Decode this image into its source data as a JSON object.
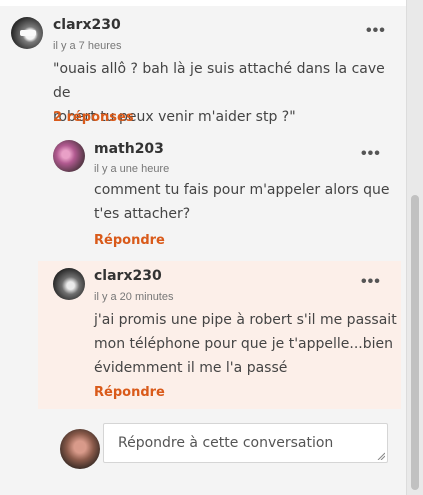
{
  "comment": {
    "username": "clarx230",
    "time": "il y a 7 heures",
    "text_line1": "\"ouais allô ? bah là je suis attaché dans la cave de",
    "text_line2": "robert tu peux venir m'aider stp ?\"",
    "replies_label": "2 réponses"
  },
  "replies": [
    {
      "username": "math203",
      "time": "il y a une heure",
      "text_line1": "comment tu fais pour m'appeler alors que",
      "text_line2": "t'es attacher?",
      "reply_label": "Répondre"
    },
    {
      "username": "clarx230",
      "time": "il y a 20 minutes",
      "text_line1": "j'ai promis une pipe à robert s'il me passait",
      "text_line2": "mon téléphone pour que je t'appelle...bien",
      "text_line3": "évidemment il me l'a passé",
      "reply_label": "Répondre"
    }
  ],
  "composer": {
    "placeholder": "Répondre à cette conversation"
  },
  "icons": {
    "more": "more-options-icon",
    "avatar": "avatar-image"
  },
  "colors": {
    "accent": "#d95a1a",
    "highlight_bg": "#fcefe9"
  }
}
